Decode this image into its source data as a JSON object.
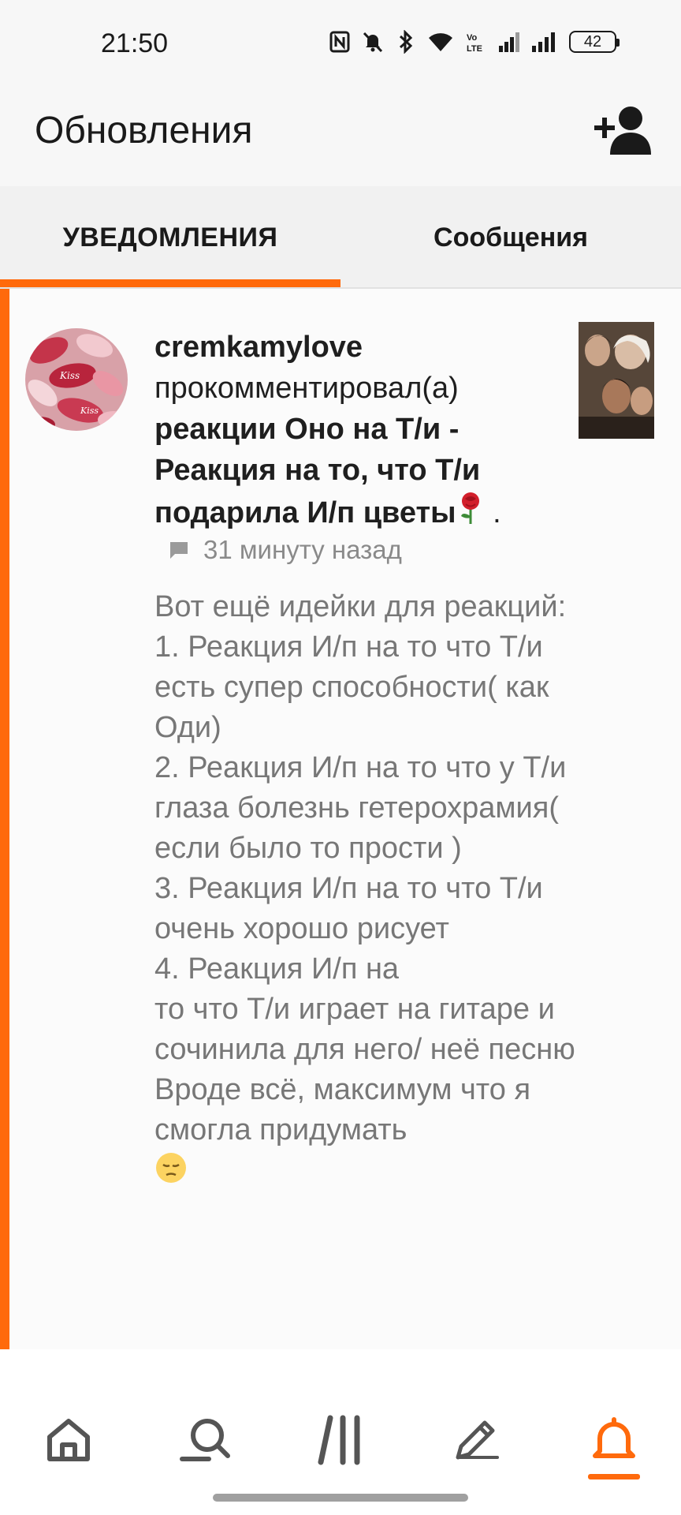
{
  "status_bar": {
    "time": "21:50",
    "battery": "42",
    "icons": [
      "nfc-icon",
      "mute-icon",
      "bluetooth-icon",
      "wifi-icon",
      "volte-icon",
      "signal-icon",
      "signal-icon",
      "battery-icon"
    ]
  },
  "header": {
    "title": "Обновления",
    "action_icon": "add-friend-icon"
  },
  "tabs": [
    {
      "label": "УВЕДОМЛЕНИЯ",
      "active": true
    },
    {
      "label": "Сообщения",
      "active": false
    }
  ],
  "notification": {
    "username": "cremkamylove",
    "action": "прокомментировал(а)",
    "story_title": "реакции Оно на Т/и - Реакция на то, что Т/и подарила И/п цветы",
    "title_emoji": "rose",
    "trailing": " .",
    "meta_icon": "comment-icon",
    "time_ago": "31 минуту назад",
    "comment": "Вот ещё идейки для реакций:\n1. Реакция И/п на то что Т/и есть супер способности( как Оди)\n2. Реакция И/п на то что у Т/и глаза болезнь гетерохрамия( если было то прости )\n3. Реакция И/п на то что Т/и очень хорошо рисует\n4. Реакция И/п на\nто что Т/и играет на гитаре и сочинила для него/ неё песню\nВроде всё, максимум что я смогла придумать",
    "comment_emoji": "pensive-face"
  },
  "bottom_nav": [
    {
      "icon": "home-icon",
      "active": false
    },
    {
      "icon": "search-icon",
      "active": false
    },
    {
      "icon": "library-icon",
      "active": false
    },
    {
      "icon": "pencil-icon",
      "active": false
    },
    {
      "icon": "bell-icon",
      "active": true
    }
  ],
  "colors": {
    "accent": "#ff6a0c",
    "muted_text": "#777777"
  }
}
